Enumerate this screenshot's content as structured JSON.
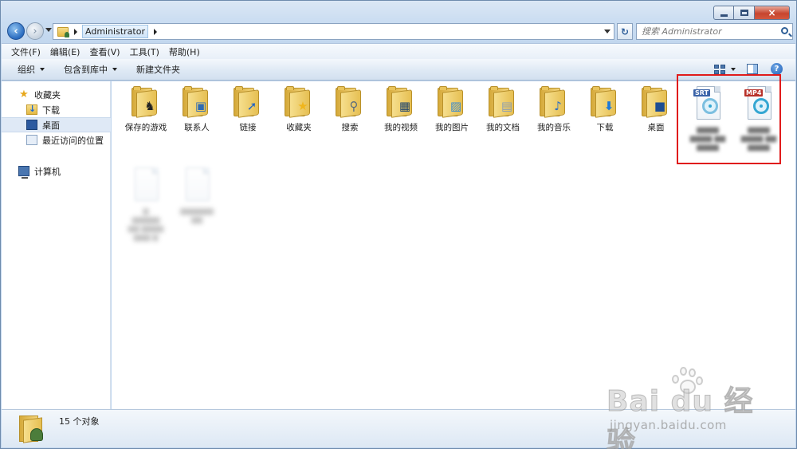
{
  "window": {
    "controls": {
      "minimize": "minimize",
      "maximize": "maximize",
      "close": "×"
    }
  },
  "nav": {
    "address_crumb": "Administrator",
    "search_placeholder": "搜索 Administrator"
  },
  "menubar": {
    "items": [
      "文件(F)",
      "编辑(E)",
      "查看(V)",
      "工具(T)",
      "帮助(H)"
    ]
  },
  "toolbar": {
    "organize": "组织",
    "include_in_library": "包含到库中",
    "new_folder": "新建文件夹"
  },
  "sidebar": {
    "favorites": "收藏夹",
    "downloads": "下载",
    "desktop": "桌面",
    "recent_places": "最近访问的位置",
    "computer": "计算机"
  },
  "content": {
    "folders": [
      {
        "label": "保存的游戏",
        "icon": "chess-knight-icon"
      },
      {
        "label": "联系人",
        "icon": "contact-card-icon"
      },
      {
        "label": "链接",
        "icon": "link-arrow-icon"
      },
      {
        "label": "收藏夹",
        "icon": "star-icon"
      },
      {
        "label": "搜索",
        "icon": "magnifier-icon"
      },
      {
        "label": "我的视频",
        "icon": "film-icon"
      },
      {
        "label": "我的图片",
        "icon": "picture-icon"
      },
      {
        "label": "我的文档",
        "icon": "document-icon"
      },
      {
        "label": "我的音乐",
        "icon": "music-note-icon"
      },
      {
        "label": "下载",
        "icon": "download-arrow-icon"
      },
      {
        "label": "桌面",
        "icon": "desktop-icon"
      }
    ],
    "highlighted_files": [
      {
        "badge": "SRT",
        "badge_color": "#3a63a8"
      },
      {
        "badge": "MP4",
        "badge_color": "#b8322a"
      }
    ],
    "highlight_color": "#e01b1b"
  },
  "status": {
    "count_text": "15 个对象"
  },
  "watermark": {
    "brand": "Bai du 经验",
    "url": "jingyan.baidu.com"
  }
}
